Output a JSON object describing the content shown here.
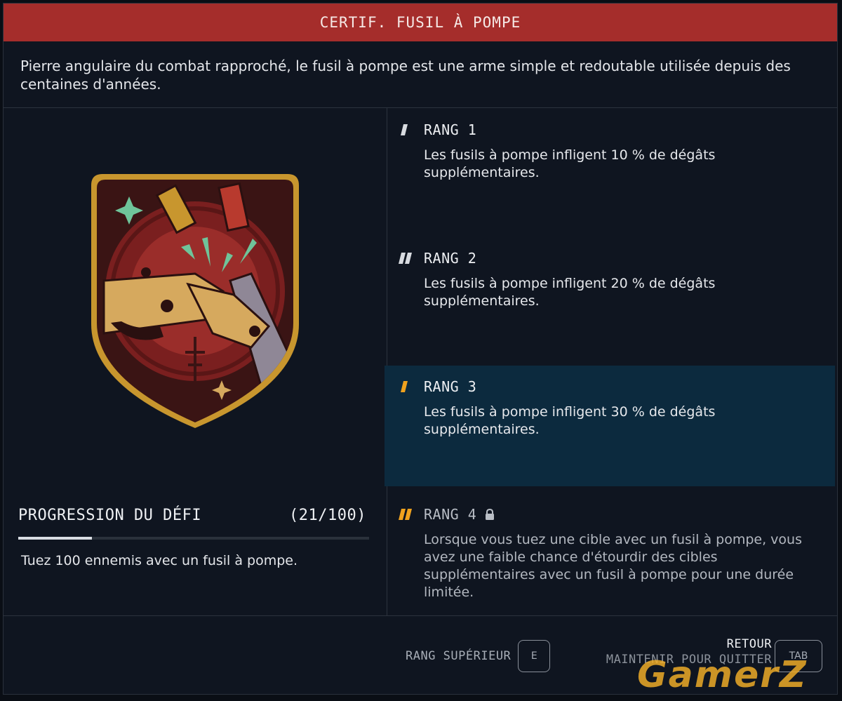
{
  "header": {
    "title": "CERTIF. FUSIL À POMPE"
  },
  "description": "Pierre angulaire du combat rapproché, le fusil à pompe est une arme simple et redoutable utilisée depuis des centaines d'années.",
  "challenge": {
    "title": "PROGRESSION DU DÉFI",
    "count": "(21/100)",
    "progress_fraction": 0.21,
    "description": "Tuez 100 ennemis avec un fusil à pompe."
  },
  "ranks": [
    {
      "label": "RANG 1",
      "description": "Les fusils à pompe infligent 10 % de dégâts supplémentaires.",
      "state": "unlocked",
      "icon": "rank-1-icon"
    },
    {
      "label": "RANG 2",
      "description": "Les fusils à pompe infligent 20 % de dégâts supplémentaires.",
      "state": "unlocked",
      "icon": "rank-2-icon"
    },
    {
      "label": "RANG 3",
      "description": "Les fusils à pompe infligent 30 % de dégâts supplémentaires.",
      "state": "selected",
      "icon": "rank-3-icon"
    },
    {
      "label": "RANG 4",
      "description": "Lorsque vous tuez une cible avec un fusil à pompe, vous avez une faible chance d'étourdir des cibles supplémentaires avec un fusil à pompe pour une durée limitée.",
      "state": "locked",
      "icon": "rank-4-icon"
    }
  ],
  "footer": {
    "upgrade_label": "RANG SUPÉRIEUR",
    "upgrade_key": "E",
    "back_label": "RETOUR",
    "hold_label": "MAINTENIR POUR QUITTER",
    "back_key": "TAB"
  },
  "watermark": "GamerZ",
  "colors": {
    "header": "#a52d2b",
    "background": "#0f1520",
    "selected_rank": "#0c2a3e",
    "rank_accent": "#f0a21e"
  }
}
